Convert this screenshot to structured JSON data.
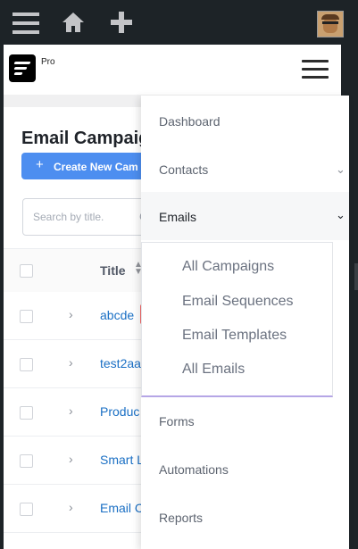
{
  "adminbar": {
    "icons": [
      "menu-icon",
      "home-icon",
      "plus-icon",
      "user-avatar"
    ]
  },
  "brand": {
    "badge": "Pro"
  },
  "page": {
    "title": "Email Campaig",
    "create_button": "Create New Cam",
    "search_placeholder": "Search by title.",
    "search_trailing": "C",
    "table": {
      "header_title": "Title",
      "rows": [
        "abcde",
        "test2aa",
        "Produc",
        "Smart L",
        "Email C"
      ]
    }
  },
  "menu": {
    "items": [
      {
        "label": "Dashboard"
      },
      {
        "label": "Contacts",
        "has_children": true
      },
      {
        "label": "Emails",
        "has_children": true,
        "active": true
      },
      {
        "label": "Forms"
      },
      {
        "label": "Automations"
      },
      {
        "label": "Reports"
      }
    ],
    "email_submenu": [
      "All Campaigns",
      "Email Sequences",
      "Email Templates",
      "All Emails"
    ]
  },
  "colors": {
    "adminbar": "#1d2327",
    "primary_button": "#4d8ef0",
    "link": "#1a6fc4",
    "submenu_underline": "#b5a6e6"
  }
}
